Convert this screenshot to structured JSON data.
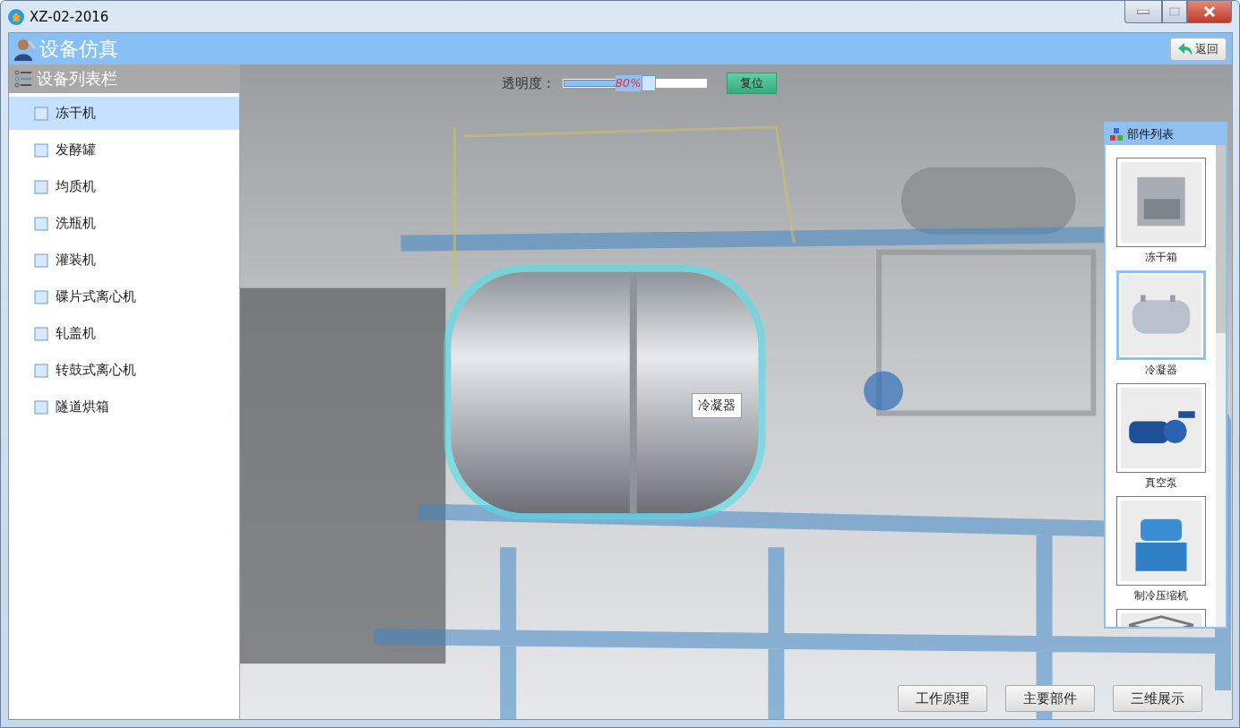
{
  "window": {
    "title": "XZ-02-2016"
  },
  "header": {
    "title": "设备仿真",
    "back_button": "返回"
  },
  "sidebar": {
    "title": "设备列表栏",
    "items": [
      {
        "label": "冻干机",
        "selected": true
      },
      {
        "label": "发酵罐",
        "selected": false
      },
      {
        "label": "均质机",
        "selected": false
      },
      {
        "label": "洗瓶机",
        "selected": false
      },
      {
        "label": "灌装机",
        "selected": false
      },
      {
        "label": "碟片式离心机",
        "selected": false
      },
      {
        "label": "轧盖机",
        "selected": false
      },
      {
        "label": "转鼓式离心机",
        "selected": false
      },
      {
        "label": "隧道烘箱",
        "selected": false
      }
    ]
  },
  "viewer": {
    "kind": "picture",
    "transparency": {
      "label": "透明度：",
      "level": 0.6,
      "reading": "80%"
    },
    "reset_button": "复位",
    "tooltip": "冷凝器"
  },
  "parts_list": {
    "title": "部件列表",
    "items": [
      {
        "label": "冻干箱",
        "selected": false,
        "kind": "box"
      },
      {
        "label": "冷凝器",
        "selected": true,
        "kind": "drum"
      },
      {
        "label": "真空泵",
        "selected": false,
        "kind": "pump"
      },
      {
        "label": "制冷压缩机",
        "selected": false,
        "kind": "compressor"
      },
      {
        "selected": false,
        "kind": "frame"
      }
    ]
  },
  "bottom_buttons": [
    "工作原理",
    "主要部件",
    "三维展示"
  ]
}
